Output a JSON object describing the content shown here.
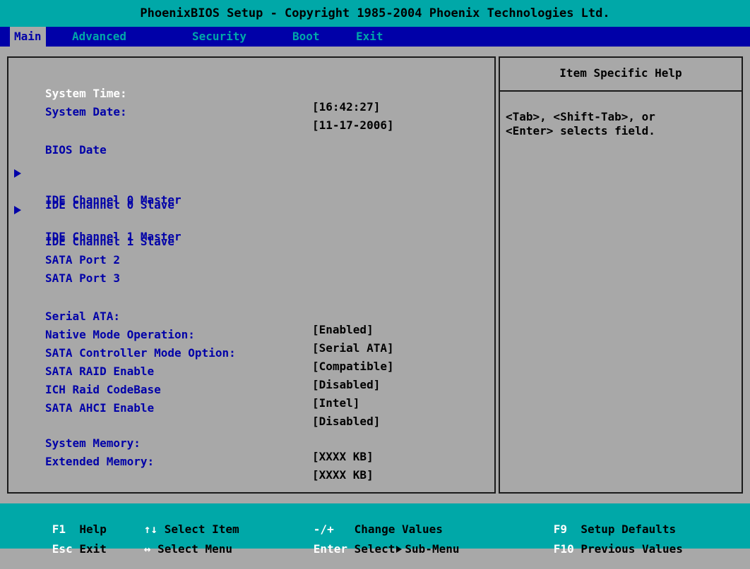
{
  "title": "PhoenixBIOS Setup - Copyright 1985-2004 Phoenix Technologies Ltd.",
  "tabs": [
    {
      "label": "Main",
      "active": true
    },
    {
      "label": "Advanced",
      "active": false
    },
    {
      "label": "Security",
      "active": false
    },
    {
      "label": "Boot",
      "active": false
    },
    {
      "label": "Exit",
      "active": false
    }
  ],
  "items": [
    {
      "label": "System Time:",
      "value": "[16:42:27]",
      "selected": true
    },
    {
      "label": "System Date:",
      "value": "[11-17-2006]"
    },
    {
      "label": "BIOS Date",
      "value": ""
    },
    {
      "label": "IDE Channel 0 Master",
      "submenu": true
    },
    {
      "label": "IDE Channel 0 Slave"
    },
    {
      "label": "IDE Channel 1 Master",
      "submenu": true
    },
    {
      "label": "IDE Channel 1 Slave"
    },
    {
      "label": "SATA Port 2"
    },
    {
      "label": "SATA Port 3"
    },
    {
      "label": "Serial ATA:",
      "value": "[Enabled]"
    },
    {
      "label": "Native Mode Operation:",
      "value": "[Serial ATA]"
    },
    {
      "label": "SATA Controller Mode Option:",
      "value": "[Compatible]"
    },
    {
      "label": "SATA RAID Enable",
      "value": "[Disabled]"
    },
    {
      "label": "ICH Raid CodeBase",
      "value": "[Intel]"
    },
    {
      "label": "SATA AHCI Enable",
      "value": "[Disabled]"
    },
    {
      "label": "System Memory:",
      "value": "[XXXX KB]"
    },
    {
      "label": "Extended Memory:",
      "value": "[XXXX KB]"
    }
  ],
  "help": {
    "title": "Item Specific Help",
    "lines": [
      "<Tab>, <Shift-Tab>, or",
      "<Enter> selects field."
    ]
  },
  "footer": [
    {
      "key": "F1",
      "desc": "Help"
    },
    {
      "key": "↑↓",
      "desc": "Select Item"
    },
    {
      "key": "-/+",
      "desc": "Change Values"
    },
    {
      "key": "F9",
      "desc": "Setup Defaults"
    },
    {
      "key": "Esc",
      "desc": "Exit"
    },
    {
      "key": "↔",
      "desc": "Select Menu"
    },
    {
      "key": "Enter",
      "desc": "Select",
      "desc2": "Sub-Menu"
    },
    {
      "key": "F10",
      "desc": "Previous Values"
    }
  ],
  "colors": {
    "menu_bar": "#0000a8",
    "title_bar": "#00a8a8",
    "panel": "#a8a8a8",
    "label": "#0000a8",
    "selected": "#ffffff"
  }
}
